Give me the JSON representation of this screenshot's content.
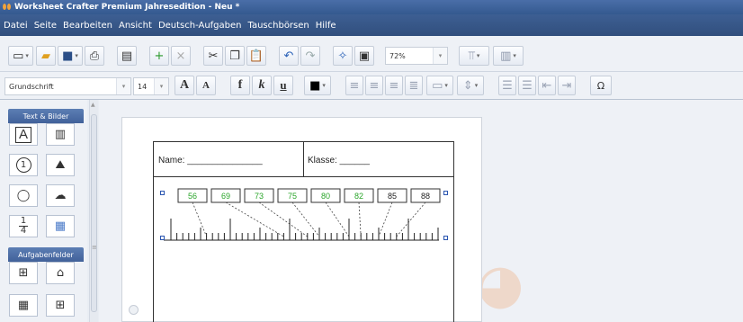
{
  "window": {
    "title": "Worksheet Crafter Premium Jahresedition - Neu *"
  },
  "menu": [
    "Datei",
    "Seite",
    "Bearbeiten",
    "Ansicht",
    "Deutsch-Aufgaben",
    "Tauschbörsen",
    "Hilfe"
  ],
  "toolbar": {
    "zoom": "72%",
    "font_family": "Grundschrift",
    "font_size": "14",
    "bold_label": "f",
    "italic_label": "k",
    "underline_label": "u",
    "grow_font_label": "A",
    "shrink_font_label": "A",
    "special_char_label": "Ω"
  },
  "sidebar": {
    "section1": "Text & Bilder",
    "section2": "Aufgabenfelder",
    "number_label": "1",
    "fraction_top": "1",
    "fraction_bottom": "4",
    "text_label": "A"
  },
  "worksheet": {
    "name_label": "Name: _______________",
    "class_label": "Klasse: ______",
    "number_boxes": [
      {
        "value": "56",
        "color": "#2aa52a"
      },
      {
        "value": "69",
        "color": "#2aa52a"
      },
      {
        "value": "73",
        "color": "#2aa52a"
      },
      {
        "value": "75",
        "color": "#2aa52a"
      },
      {
        "value": "80",
        "color": "#2aa52a"
      },
      {
        "value": "82",
        "color": "#2aa52a"
      },
      {
        "value": "85",
        "color": "#222222"
      },
      {
        "value": "88",
        "color": "#222222"
      }
    ]
  },
  "colors": {
    "accent": "#3d5f93",
    "green": "#2aa52a"
  }
}
